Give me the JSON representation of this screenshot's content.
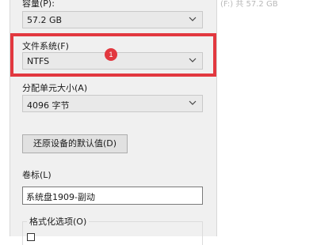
{
  "background": {
    "partial_text": "(F:) 共 57.2 GB"
  },
  "dialog": {
    "capacity_label": "容量(P):",
    "capacity_value": "57.2 GB",
    "filesystem_label": "文件系统(F)",
    "filesystem_value": "NTFS",
    "allocation_label": "分配单元大小(A)",
    "allocation_value": "4096 字节",
    "restore_button": "还原设备的默认值(D)",
    "volume_label": "卷标(L)",
    "volume_value": "系统盘1909-副动",
    "format_options_label": "格式化选项(O)"
  },
  "annotation": {
    "badge_number": "1",
    "color": "#e2383f"
  },
  "icons": {
    "dropdown": "chevron-down-icon"
  }
}
